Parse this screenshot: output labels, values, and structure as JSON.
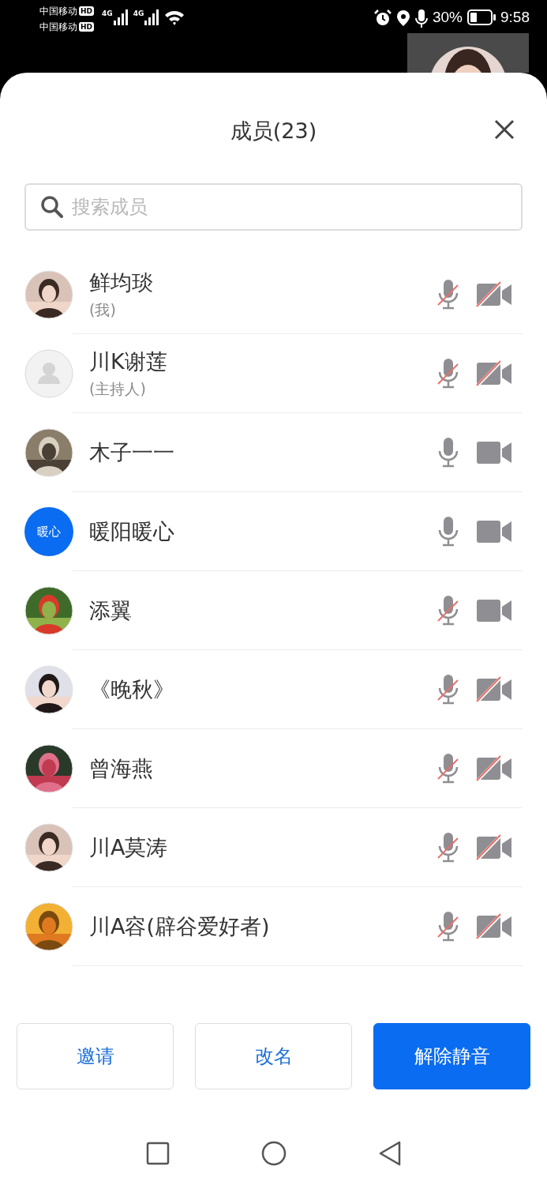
{
  "status_bar": {
    "carriers": [
      {
        "name": "中国移动",
        "badge": "HD"
      },
      {
        "name": "中国移动",
        "badge": "HD"
      }
    ],
    "networks": [
      "4G",
      "4G"
    ],
    "battery": "30%",
    "time": "9:58"
  },
  "header": {
    "title": "成员(23)"
  },
  "search": {
    "placeholder": "搜索成员"
  },
  "members": [
    {
      "name": "鲜均琰",
      "subtitle": "(我)",
      "kind": "picture",
      "mic_muted": true,
      "camera_off": true
    },
    {
      "name": "川K谢莲",
      "subtitle": "(主持人)",
      "kind": "placeholder",
      "mic_muted": true,
      "camera_off": true
    },
    {
      "name": "木子一一",
      "kind": "picture",
      "mic_muted": false,
      "camera_off": false
    },
    {
      "name": "暖阳暖心",
      "kind": "text",
      "avatar_text": "暖心",
      "mic_muted": false,
      "camera_off": false
    },
    {
      "name": "添翼",
      "kind": "picture",
      "mic_muted": true,
      "camera_off": false
    },
    {
      "name": "《晚秋》",
      "kind": "picture",
      "mic_muted": true,
      "camera_off": true
    },
    {
      "name": "曾海燕",
      "kind": "picture",
      "mic_muted": true,
      "camera_off": true
    },
    {
      "name": "川A莫涛",
      "kind": "picture",
      "mic_muted": true,
      "camera_off": true
    },
    {
      "name": "川A容(辟谷爱好者)",
      "kind": "picture",
      "mic_muted": true,
      "camera_off": true
    }
  ],
  "buttons": [
    {
      "label": "邀请",
      "primary": false
    },
    {
      "label": "改名",
      "primary": false
    },
    {
      "label": "解除静音",
      "primary": true
    }
  ]
}
